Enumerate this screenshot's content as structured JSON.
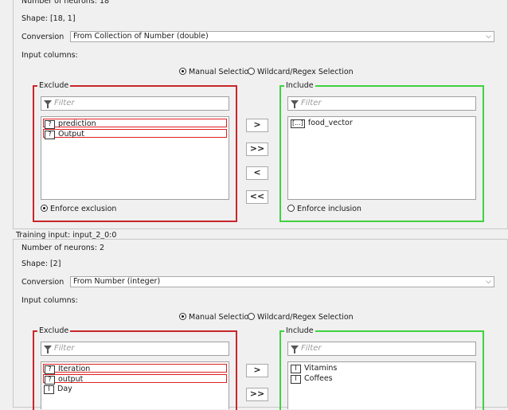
{
  "section1": {
    "neurons_label": "Number of neurons: 18",
    "shape_label": "Shape: [18, 1]",
    "conversion_label": "Conversion",
    "conversion_value": "From Collection of Number (double)",
    "input_columns_label": "Input columns:",
    "mode_manual": "Manual Selection",
    "mode_wildcard": "Wildcard/Regex Selection",
    "exclude": {
      "title": "Exclude",
      "filter_placeholder": "Filter",
      "items": [
        {
          "badge": "?",
          "label": "prediction"
        },
        {
          "badge": "?",
          "label": "Output"
        }
      ],
      "enforce_label": "Enforce exclusion"
    },
    "include": {
      "title": "Include",
      "filter_placeholder": "Filter",
      "items": [
        {
          "badge": "[...]",
          "label": "food_vector"
        }
      ],
      "enforce_label": "Enforce inclusion"
    },
    "buttons": {
      "add": ">",
      "add_all": ">>",
      "remove": "<",
      "remove_all": "<<"
    }
  },
  "section2": {
    "title": "Training input: input_2_0:0",
    "neurons_label": "Number of neurons: 2",
    "shape_label": "Shape: [2]",
    "conversion_label": "Conversion",
    "conversion_value": "From Number (integer)",
    "input_columns_label": "Input columns:",
    "mode_manual": "Manual Selection",
    "mode_wildcard": "Wildcard/Regex Selection",
    "exclude": {
      "title": "Exclude",
      "filter_placeholder": "Filter",
      "items": [
        {
          "badge": "?",
          "label": "Iteration"
        },
        {
          "badge": "?",
          "label": "output"
        },
        {
          "badge": "I",
          "label": "Day"
        }
      ]
    },
    "include": {
      "title": "Include",
      "filter_placeholder": "Filter",
      "items": [
        {
          "badge": "I",
          "label": "Vitamins"
        },
        {
          "badge": "I",
          "label": "Coffees"
        }
      ]
    },
    "buttons": {
      "add": ">",
      "add_all": ">>"
    }
  },
  "colors": {
    "exclude_border": "#c8262a",
    "include_border": "#3fd23f",
    "error_outline": "#e02020"
  }
}
